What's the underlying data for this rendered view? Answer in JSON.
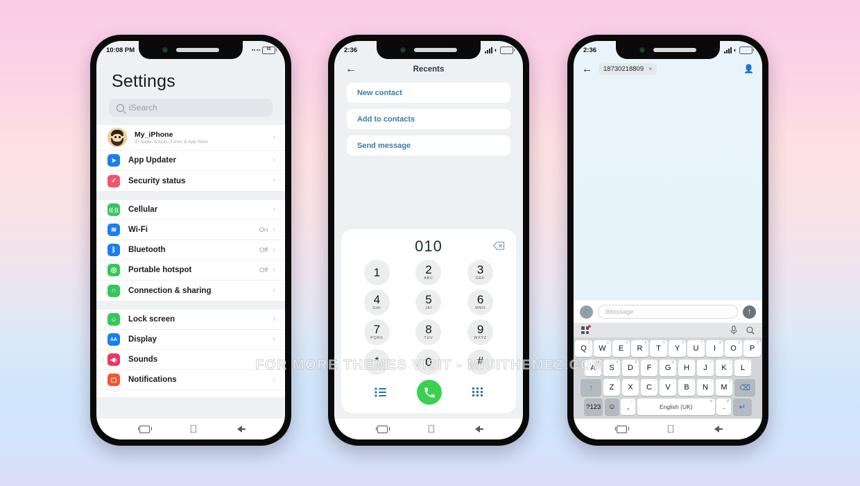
{
  "watermark": "FOR MORE THEMES VISIT - MIUITHEMEZ.COM",
  "colors": {
    "accent_blue": "#3a7ca8",
    "call_green": "#3ad14f",
    "key_blue": "#2a7fc4",
    "bg_gradient_top": "#fbcbe8",
    "bg_gradient_bottom": "#dbddf7"
  },
  "phone1": {
    "status": {
      "time": "10:08 PM",
      "battery": "92"
    },
    "title": "Settings",
    "search": {
      "placeholder": "iSearch",
      "icon": "search-icon"
    },
    "account": {
      "name": "My_iPhone",
      "subtitle": "ID Apple, iCloud, iTunes & App Store",
      "chevron": "›"
    },
    "groups": [
      {
        "items": [
          {
            "label": "App Updater",
            "value": "",
            "icon": "paper-plane-icon",
            "color": "#1a7ef0",
            "glyph": "➤"
          },
          {
            "label": "Security status",
            "value": "",
            "icon": "shield-check-icon",
            "color": "#f0566e",
            "glyph": "✓"
          }
        ]
      },
      {
        "items": [
          {
            "label": "Cellular",
            "value": "",
            "icon": "cellular-icon",
            "color": "#34c759",
            "glyph": "ᴀ"
          },
          {
            "label": "Wi-Fi",
            "value": "On",
            "icon": "wifi-icon",
            "color": "#1a7ef0",
            "glyph": "◑"
          },
          {
            "label": "Bluetooth",
            "value": "Off",
            "icon": "bluetooth-icon",
            "color": "#1a7ef0",
            "glyph": "ᛦ"
          },
          {
            "label": "Portable hotspot",
            "value": "Off",
            "icon": "hotspot-icon",
            "color": "#34c759",
            "glyph": "◎"
          },
          {
            "label": "Connection & sharing",
            "value": "",
            "icon": "connection-sharing-icon",
            "color": "#34c759",
            "glyph": "∩"
          }
        ]
      },
      {
        "items": [
          {
            "label": "Lock screen",
            "value": "",
            "icon": "lock-screen-icon",
            "color": "#34c759",
            "glyph": "☺"
          },
          {
            "label": "Display",
            "value": "",
            "icon": "display-icon",
            "color": "#1a7ef0",
            "glyph": "AA"
          },
          {
            "label": "Sounds",
            "value": "",
            "icon": "sounds-icon",
            "color": "#f0365e",
            "glyph": "ὐA"
          },
          {
            "label": "Notifications",
            "value": "",
            "icon": "notifications-icon",
            "color": "#f2552f",
            "glyph": "▢"
          }
        ]
      }
    ],
    "nav": {
      "recents": "recents-icon",
      "home": "apple-home-icon",
      "back": "back-icon"
    }
  },
  "phone2": {
    "status": {
      "time": "2:36"
    },
    "header": {
      "back": "←",
      "title": "Recents"
    },
    "options": [
      {
        "label": "New contact"
      },
      {
        "label": "Add to contacts"
      },
      {
        "label": "Send message"
      }
    ],
    "dialer": {
      "number": "010",
      "backspace_icon": "backspace-icon",
      "keys": [
        {
          "digit": "1",
          "sub": ""
        },
        {
          "digit": "2",
          "sub": "ABC"
        },
        {
          "digit": "3",
          "sub": "DEF"
        },
        {
          "digit": "4",
          "sub": "GHI"
        },
        {
          "digit": "5",
          "sub": "JKl"
        },
        {
          "digit": "6",
          "sub": "MNO"
        },
        {
          "digit": "7",
          "sub": "PQRS"
        },
        {
          "digit": "8",
          "sub": "TUV"
        },
        {
          "digit": "9",
          "sub": "WXYZ"
        },
        {
          "digit": "*",
          "sub": ""
        },
        {
          "digit": "0",
          "sub": ""
        },
        {
          "digit": "#",
          "sub": ""
        }
      ],
      "actions": {
        "list_icon": "call-log-list-icon",
        "call_icon": "call-button-icon",
        "keypad_icon": "keypad-grid-icon"
      }
    },
    "nav": {
      "recents": "recents-icon",
      "home": "apple-home-icon",
      "back": "back-icon"
    }
  },
  "phone3": {
    "status": {
      "time": "2:36"
    },
    "header": {
      "back": "←",
      "recipient": "18730218809",
      "chip_close": "×",
      "add_person_icon": "add-person-icon"
    },
    "composer": {
      "attach_icon": "attachment-clip-icon",
      "placeholder": "iMessage",
      "send_icon": "send-arrow-icon"
    },
    "kbtoolbar": {
      "apps_icon": "keyboard-apps-icon",
      "mic_icon": "microphone-icon",
      "search_icon": "search-icon"
    },
    "keyboard": {
      "row1": [
        {
          "k": "Q",
          "n": "1"
        },
        {
          "k": "W",
          "n": "2"
        },
        {
          "k": "E",
          "n": "3"
        },
        {
          "k": "R",
          "n": "4"
        },
        {
          "k": "T",
          "n": "5"
        },
        {
          "k": "Y",
          "n": "6"
        },
        {
          "k": "U",
          "n": "7"
        },
        {
          "k": "I",
          "n": "8"
        },
        {
          "k": "O",
          "n": "9"
        },
        {
          "k": "P",
          "n": "0"
        }
      ],
      "row2": [
        {
          "k": "A",
          "n": "@"
        },
        {
          "k": "S",
          "n": "#"
        },
        {
          "k": "D",
          "n": "$"
        },
        {
          "k": "F",
          "n": "_"
        },
        {
          "k": "G",
          "n": "&"
        },
        {
          "k": "H",
          "n": "-"
        },
        {
          "k": "J",
          "n": "+"
        },
        {
          "k": "K",
          "n": "("
        },
        {
          "k": "L",
          "n": ")"
        }
      ],
      "row3": [
        {
          "k": "Z",
          "n": "*"
        },
        {
          "k": "X",
          "n": "\""
        },
        {
          "k": "C",
          "n": "'"
        },
        {
          "k": "V",
          "n": ":"
        },
        {
          "k": "B",
          "n": ";"
        },
        {
          "k": "N",
          "n": "!"
        },
        {
          "k": "M",
          "n": "?"
        }
      ],
      "shift": "↑",
      "backspace": "⌫",
      "numbers": "?123",
      "emoji": "☺",
      "comma": ",",
      "comma_sup": "☼",
      "space_label": "English (UK)",
      "space_sup": "⊕",
      "period": ".",
      "period_sup": "⁋",
      "enter": "↵"
    },
    "nav": {
      "recents": "recents-icon",
      "home": "apple-home-icon",
      "back": "back-icon"
    }
  }
}
